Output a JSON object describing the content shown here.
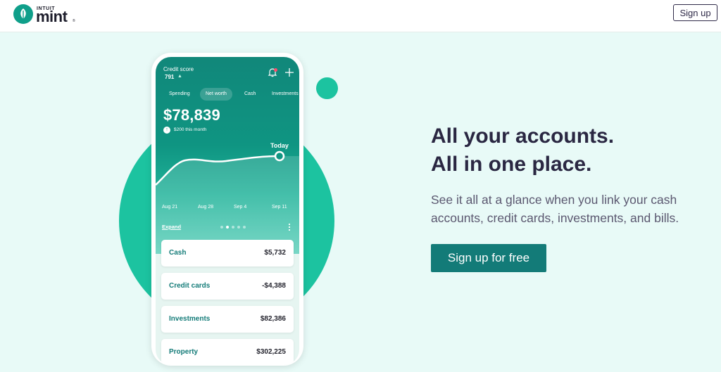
{
  "brand": {
    "small_text": "INTUIT",
    "name": "mint",
    "reg": "®"
  },
  "header": {
    "signup_label": "Sign up"
  },
  "phone": {
    "credit_score_label": "Credit score",
    "credit_score_value": "791",
    "credit_score_trend": "▲",
    "tabs": [
      "Spending",
      "Net worth",
      "Cash",
      "Investments"
    ],
    "active_tab": "Net worth",
    "net_worth": "$78,839",
    "month_badge": "↑",
    "month_delta": "$200 this month",
    "chart_marker_label": "Today",
    "x_labels": [
      "Aug 21",
      "Aug 28",
      "Sep 4",
      "Sep 11"
    ],
    "expand_label": "Expand",
    "pager_total": 5,
    "pager_active": 2,
    "accounts": [
      {
        "label": "Cash",
        "value": "$5,732"
      },
      {
        "label": "Credit cards",
        "value": "-$4,388"
      },
      {
        "label": "Investments",
        "value": "$82,386"
      },
      {
        "label": "Property",
        "value": "$302,225"
      }
    ]
  },
  "hero": {
    "headline_line1": "All your accounts.",
    "headline_line2": "All in one place.",
    "subtext": "See it all at a glance when you link your cash accounts, credit cards, investments, and bills.",
    "cta_label": "Sign up for free"
  },
  "colors": {
    "brand_teal": "#137b78",
    "accent_green": "#1cc3a0",
    "page_background": "#e8faf7",
    "headline": "#2a2742"
  }
}
